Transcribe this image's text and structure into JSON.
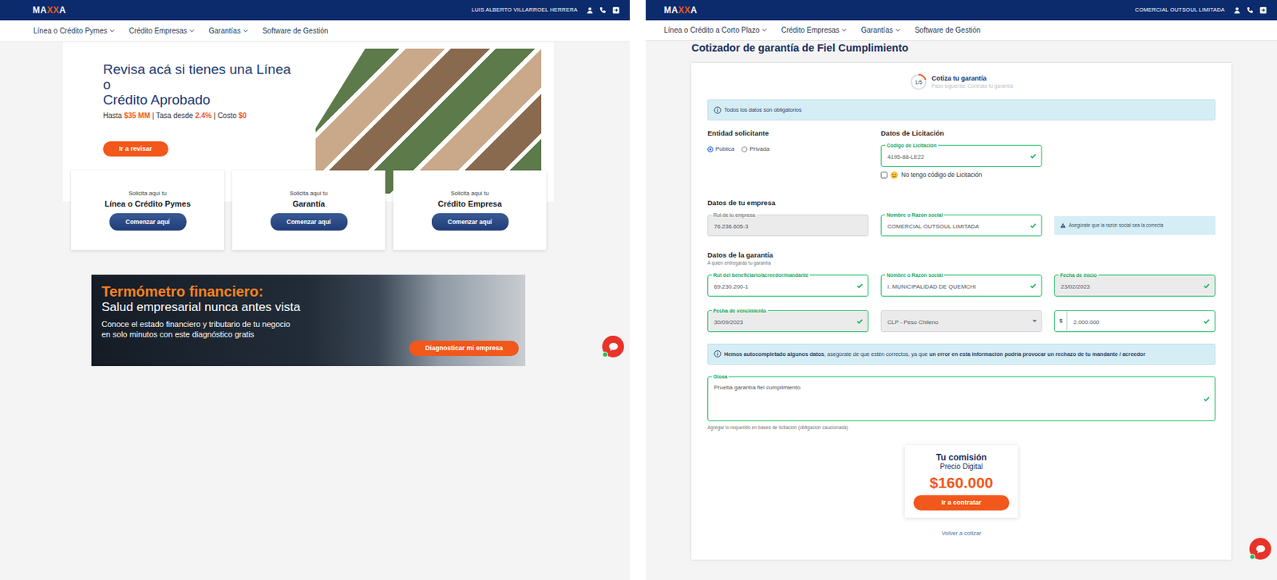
{
  "left": {
    "header": {
      "logo": [
        {
          "text": "MA",
          "accent": false
        },
        {
          "text": "XX",
          "accent": true
        },
        {
          "text": "A",
          "accent": false
        }
      ],
      "user": "LUIS ALBERTO VILLARROEL HERRERA"
    },
    "nav": [
      {
        "label": "Línea o Crédito Pymes",
        "dropdown": true
      },
      {
        "label": "Crédito Empresas",
        "dropdown": true
      },
      {
        "label": "Garantías",
        "dropdown": true
      },
      {
        "label": "Software de Gestión",
        "dropdown": false
      }
    ],
    "hero": {
      "title": [
        "Revisa acá si tienes una Línea o",
        "Crédito Aprobado"
      ],
      "subtitle": [
        {
          "text": "Hasta ",
          "highlight": false
        },
        {
          "text": "$35 MM",
          "highlight": true
        },
        {
          "text": " | Tasa desde ",
          "highlight": false
        },
        {
          "text": "2.4%",
          "highlight": true
        },
        {
          "text": " | Costo ",
          "highlight": false
        },
        {
          "text": "$0",
          "highlight": true
        }
      ],
      "button": "Ir a revisar"
    },
    "cards": [
      {
        "pre": "Solicita aquí tu",
        "title": "Línea o Crédito Pymes",
        "button": "Comenzar aquí"
      },
      {
        "pre": "Solicita aquí tu",
        "title": "Garantía",
        "button": "Comenzar aquí"
      },
      {
        "pre": "Solicita aquí tu",
        "title": "Crédito Empresa",
        "button": "Comenzar aquí"
      }
    ],
    "banner": {
      "title": "Termómetro financiero:",
      "subtitle": "Salud empresarial nunca antes vista",
      "body": [
        "Conoce el estado financiero y tributario de tu negocio",
        "en solo minutos con este diagnóstico gratis"
      ],
      "button": "Diagnosticar mi empresa"
    },
    "chat": {
      "online": true
    }
  },
  "right": {
    "header": {
      "logo": [
        {
          "text": "MA",
          "accent": false
        },
        {
          "text": "XX",
          "accent": true
        },
        {
          "text": "A",
          "accent": false
        }
      ],
      "user": "COMERCIAL OUTSOUL LIMITADA"
    },
    "nav": [
      {
        "label": "Línea o Crédito a Corto Plazo",
        "dropdown": true
      },
      {
        "label": "Crédito Empresas",
        "dropdown": true
      },
      {
        "label": "Garantías",
        "dropdown": true
      },
      {
        "label": "Software de Gestión",
        "dropdown": false
      }
    ],
    "page_title": "Cotizador de garantía de Fiel Cumplimiento",
    "step": {
      "counter": "1/5",
      "level": 0.2,
      "title": "Cotiza tu garantía",
      "next": "Paso siguiente: Contrata tu garantía"
    },
    "notice": "Todos los datos son obligatorios",
    "entity": {
      "heading": "Entidad solicitante",
      "options": [
        {
          "label": "Pública",
          "selected": true
        },
        {
          "label": "Privada",
          "selected": false
        }
      ]
    },
    "tender": {
      "heading": "Datos de Licitación",
      "field": {
        "kind": "text",
        "label": "Código de Licitación",
        "value": "4195-88-LE22",
        "valid": true,
        "disabled": false
      },
      "no_code": {
        "label": "No tengo código de Licitación",
        "checked": false
      }
    },
    "company": {
      "heading": "Datos de tu empresa",
      "fields": [
        {
          "kind": "text",
          "label": "Rut de tu empresa",
          "value": "76.236.605-3",
          "valid": false,
          "disabled": true
        },
        {
          "kind": "text",
          "label": "Nombre o Razón social",
          "value": "COMERCIAL OUTSOUL LIMITADA",
          "valid": true,
          "disabled": false
        }
      ],
      "hint": "Asegúrate que la razón social sea la correcta"
    },
    "guarantee": {
      "heading": "Datos de la garantía",
      "subheading": "A quien entregarás tu garantía",
      "fields": [
        {
          "kind": "text",
          "label": "Rut del beneficiario/acreedor/mandante",
          "value": "69.230.200-1",
          "valid": true,
          "disabled": false
        },
        {
          "kind": "text",
          "label": "Nombre o Razón social",
          "value": "I. MUNICIPALIDAD DE QUEMCHI",
          "valid": true,
          "disabled": false
        },
        {
          "kind": "text",
          "label": "Fecha de inicio",
          "value": "23/02/2023",
          "valid": true,
          "disabled": true
        },
        {
          "kind": "text",
          "label": "Fecha de vencimiento",
          "value": "30/09/2023",
          "valid": true,
          "disabled": true
        },
        {
          "kind": "select",
          "value": "CLP - Peso Chileno",
          "valid": false,
          "disabled": true
        },
        {
          "kind": "amount",
          "prefix": "$",
          "value": "2.000.000",
          "valid": true,
          "disabled": false
        }
      ]
    },
    "autofill": [
      {
        "text": "Hemos autocompletado algunos datos",
        "bold": true
      },
      {
        "text": ", asegúrate de que estén correctos, ya que ",
        "bold": false
      },
      {
        "text": "un error en esta información podría provocar un rechazo de tu mandante / acreedor",
        "bold": true
      }
    ],
    "glosa": {
      "kind": "textarea",
      "label": "Glosa",
      "value": "Prueba garantía fiel cumplimiento",
      "valid": true,
      "disabled": false,
      "help": "Agregar lo requerido en bases de licitación (obligación caucionada)"
    },
    "commission": {
      "title": "Tu comisión",
      "subtitle": "Precio Digital",
      "amount": "$160.000",
      "button": "Ir a contratar"
    },
    "back": "Volver a cotizar",
    "chat": {
      "online": true
    }
  }
}
